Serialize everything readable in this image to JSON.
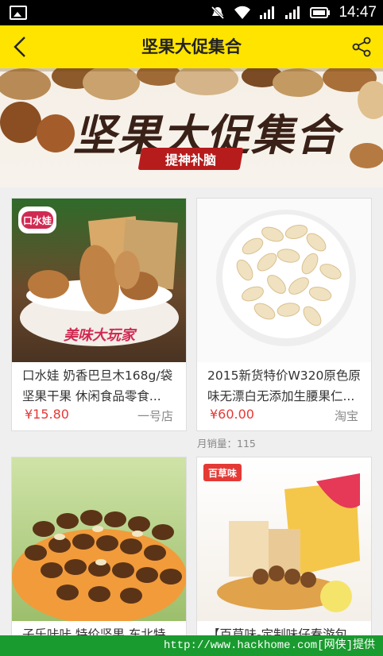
{
  "status_bar": {
    "time": "14:47",
    "icons": [
      "image-icon",
      "mute-icon",
      "wifi-icon",
      "signal-icon",
      "signal-icon-2",
      "battery-icon"
    ]
  },
  "header": {
    "title": "坚果大促集合",
    "back_icon": "chevron-left-icon",
    "share_icon": "share-icon",
    "background": "#ffe400"
  },
  "banner": {
    "title": "坚果大促集合",
    "tag": "提神补脑"
  },
  "products": [
    {
      "name": "口水娃 奶香巴旦木168g/袋 坚果干果 休闲食品零食...",
      "price": "¥15.80",
      "store": "一号店",
      "image_label": "口水娃",
      "image_text": "美味大玩家"
    },
    {
      "name": "2015新货特价W320原色原味无漂白无添加生腰果仁...",
      "price": "¥60.00",
      "store": "淘宝",
      "sales": "月销量：115"
    },
    {
      "name": "子乐咔咔 特价坚果 东北特",
      "price": "",
      "store": ""
    },
    {
      "name": "【百草味-定制味仔春游包",
      "price": "",
      "store": "",
      "image_label": "百草味"
    }
  ],
  "watermark": "http://www.hackhome.com[网侠]提供",
  "colors": {
    "accent": "#ffe400",
    "price": "#e53935",
    "watermark_bg": "#1a9b2f"
  }
}
